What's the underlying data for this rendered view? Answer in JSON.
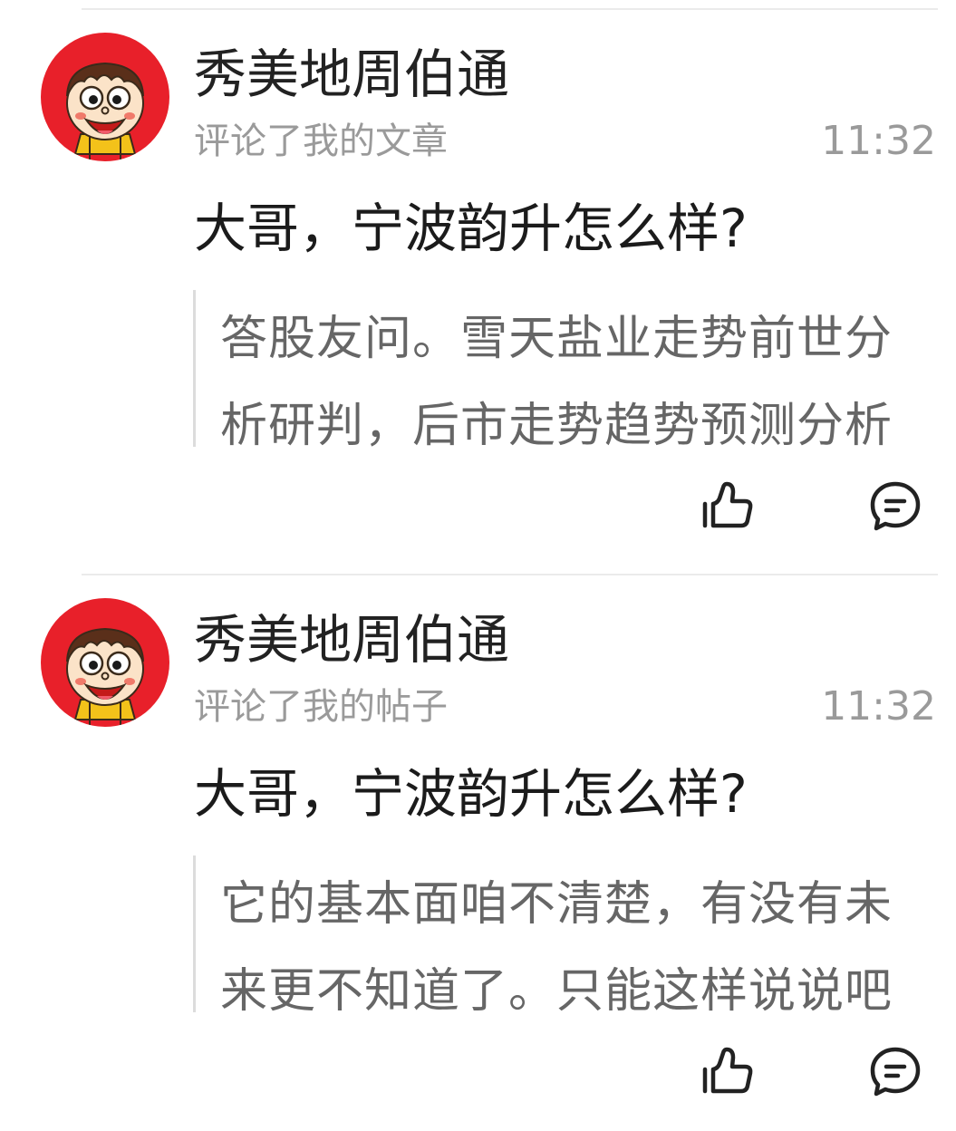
{
  "notifications": [
    {
      "user_name": "秀美地周伯通",
      "action": "评论了我的文章",
      "time": "11:32",
      "comment": "大哥，宁波韵升怎么样?",
      "quoted_text": "答股友问。雪天盐业走势前世分析研判，后市走势趋势预测分析",
      "avatar_icon": "cartoon-boy-avatar",
      "like_icon": "thumbs-up-icon",
      "reply_icon": "comment-bubble-icon"
    },
    {
      "user_name": "秀美地周伯通",
      "action": "评论了我的帖子",
      "time": "11:32",
      "comment": "大哥，宁波韵升怎么样?",
      "quoted_text": "它的基本面咱不清楚，有没有未来更不知道了。只能这样说说吧",
      "avatar_icon": "cartoon-boy-avatar",
      "like_icon": "thumbs-up-icon",
      "reply_icon": "comment-bubble-icon"
    }
  ],
  "colors": {
    "avatar_red": "#e8202a",
    "text_primary": "#222222",
    "text_secondary": "#9a9a9a",
    "quote_text": "#666666",
    "divider": "#ebebeb"
  }
}
